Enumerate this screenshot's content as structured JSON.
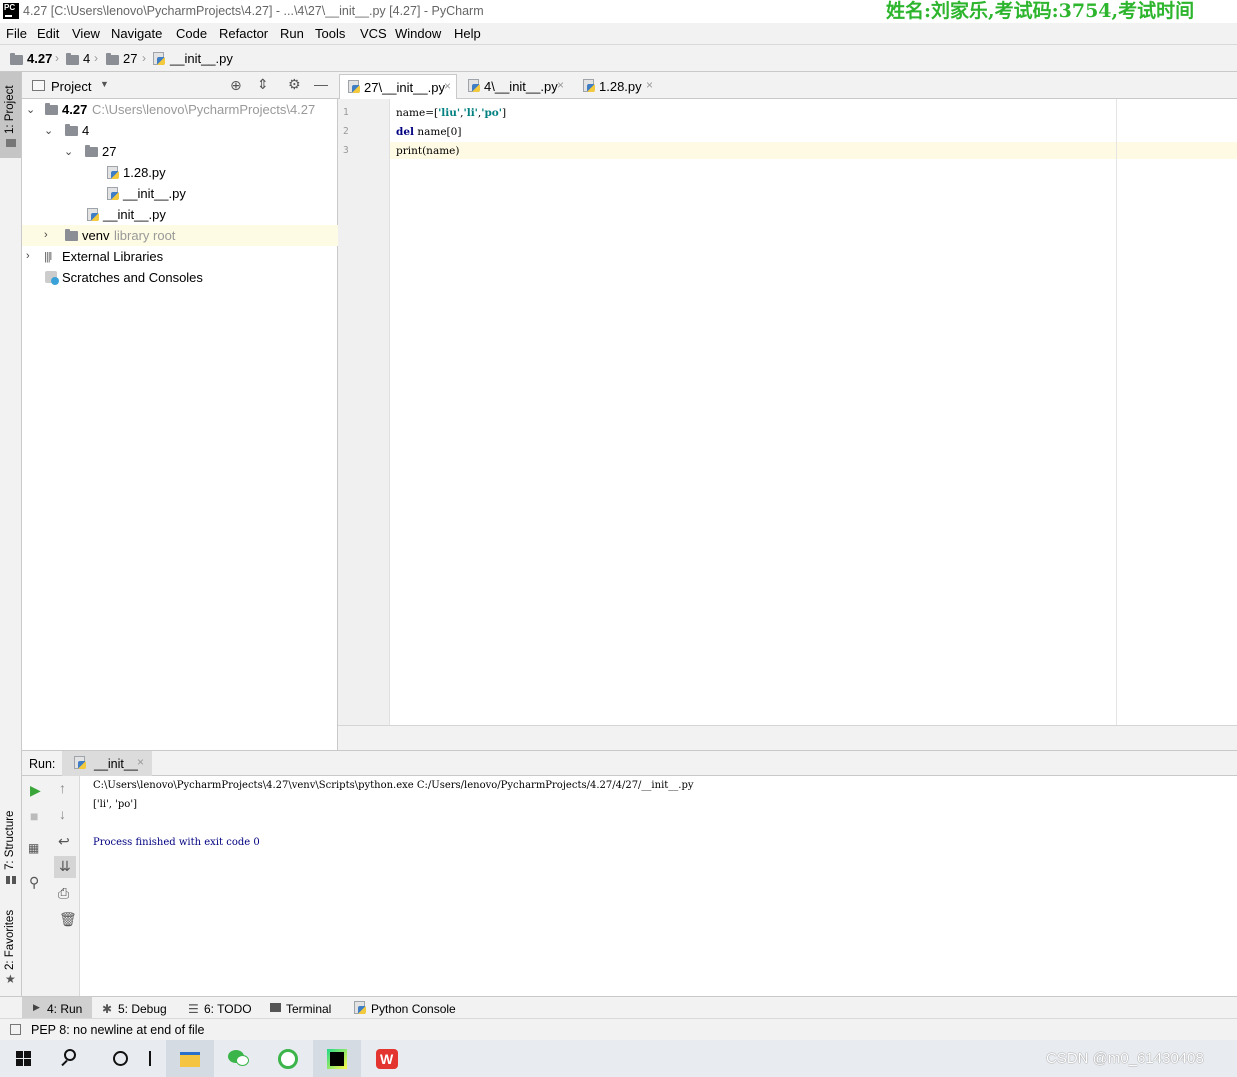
{
  "window": {
    "title": "4.27 [C:\\Users\\lenovo\\PycharmProjects\\4.27] - ...\\4\\27\\__init__.py [4.27] - PyCharm",
    "watermark": "姓名:刘家乐,考试码:3754,考试时间"
  },
  "menu": [
    "File",
    "Edit",
    "View",
    "Navigate",
    "Code",
    "Refactor",
    "Run",
    "Tools",
    "VCS",
    "Window",
    "Help"
  ],
  "breadcrumb": [
    "4.27",
    "4",
    "27",
    "__init__.py"
  ],
  "left_stripe": {
    "project": "1: Project",
    "structure": "7: Structure",
    "favorites": "2: Favorites"
  },
  "project": {
    "header": "Project",
    "tree": [
      {
        "label": "4.27",
        "extra": "C:\\Users\\lenovo\\PycharmProjects\\4.27"
      },
      {
        "label": "4"
      },
      {
        "label": "27"
      },
      {
        "label": "1.28.py"
      },
      {
        "label": "__init__.py"
      },
      {
        "label": "__init__.py"
      },
      {
        "label": "venv",
        "extra": "library root"
      },
      {
        "label": "External Libraries"
      },
      {
        "label": "Scratches and Consoles"
      }
    ]
  },
  "editor": {
    "tabs": [
      "27\\__init__.py",
      "4\\__init__.py",
      "1.28.py"
    ],
    "line_numbers": [
      "1",
      "2",
      "3"
    ],
    "code": {
      "l1_a": "name=[",
      "l1_s1": "'liu'",
      "l1_c1": ",",
      "l1_s2": "'li'",
      "l1_c2": ",",
      "l1_s3": "'po'",
      "l1_e": "]",
      "l2_kw": "del",
      "l2_rest": " name[0]",
      "l3": "print(name)"
    }
  },
  "run": {
    "label": "Run:",
    "tab": "__init__",
    "output": [
      "C:\\Users\\lenovo\\PycharmProjects\\4.27\\venv\\Scripts\\python.exe C:/Users/lenovo/PycharmProjects/4.27/4/27/__init__.py",
      "['li', 'po']",
      "",
      "Process finished with exit code 0"
    ]
  },
  "bottom_tabs": [
    "4: Run",
    "5: Debug",
    "6: TODO",
    "Terminal",
    "Python Console"
  ],
  "status": {
    "message": "PEP 8: no newline at end of file"
  },
  "taskbar": {
    "csdn": "CSDN @m0_61430408"
  },
  "colors": {
    "keyword": "#000080",
    "string": "#008080",
    "console_blue": "#000080",
    "watermark": "#2db52d"
  }
}
